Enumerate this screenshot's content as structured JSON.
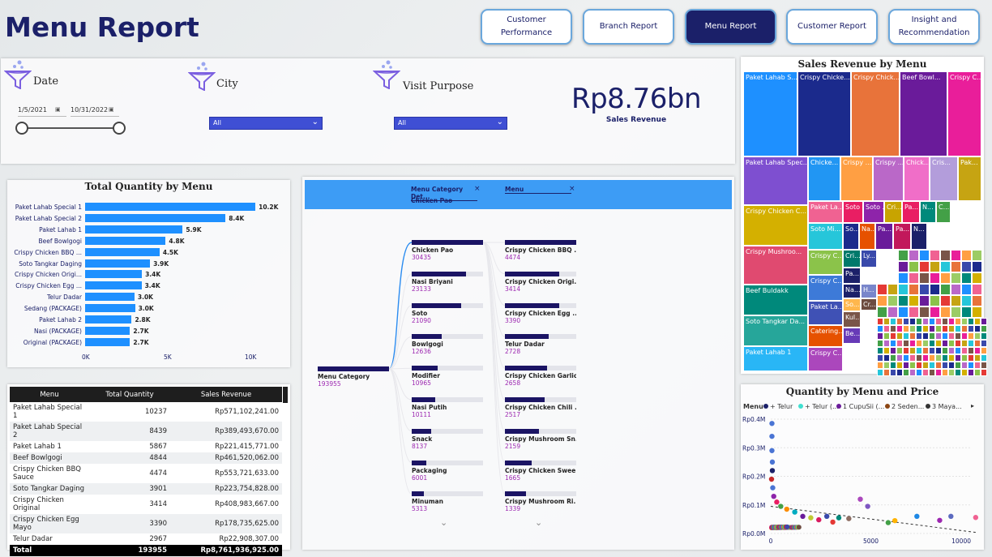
{
  "page": {
    "title": "Menu Report"
  },
  "nav": [
    {
      "label": "Customer Performance",
      "active": false
    },
    {
      "label": "Branch Report",
      "active": false
    },
    {
      "label": "Menu Report",
      "active": true
    },
    {
      "label": "Customer Report",
      "active": false
    },
    {
      "label": "Insight and Recommendation",
      "active": false
    }
  ],
  "filters": {
    "date": {
      "label": "Date",
      "start": "1/5/2021",
      "end": "10/31/2022"
    },
    "city": {
      "label": "City",
      "value": "All"
    },
    "visit_purpose": {
      "label": "Visit Purpose",
      "value": "All"
    }
  },
  "kpi": {
    "value": "Rp8.76bn",
    "label": "Sales Revenue"
  },
  "quantity_chart": {
    "title": "Total Quantity by Menu",
    "ticks": [
      "0K",
      "5K",
      "10K"
    ],
    "chart_data": {
      "type": "bar",
      "orientation": "horizontal",
      "categories": [
        "Paket Lahab Special 1",
        "Paket Lahab Special 2",
        "Paket Lahab 1",
        "Beef Bowlgogi",
        "Crispy Chicken BBQ ...",
        "Soto Tangkar Daging",
        "Crispy Chicken Origi...",
        "Crispy Chicken Egg ...",
        "Telur Dadar",
        "Sedang (PACKAGE)",
        "Paket Lahab 2",
        "Nasi (PACKAGE)",
        "Original (PACKAGE)"
      ],
      "values": [
        10237,
        8439,
        5867,
        4844,
        4474,
        3901,
        3414,
        3390,
        2967,
        3000,
        2800,
        2700,
        2700
      ],
      "labels": [
        "10.2K",
        "8.4K",
        "5.9K",
        "4.8K",
        "4.5K",
        "3.9K",
        "3.4K",
        "3.4K",
        "3.0K",
        "3.0K",
        "2.8K",
        "2.7K",
        "2.7K"
      ],
      "xlim": [
        0,
        11000
      ],
      "color": "#1e90ff"
    }
  },
  "table": {
    "headers": [
      "Menu",
      "Total Quantity",
      "Sales Revenue"
    ],
    "rows": [
      [
        "Paket Lahab Special 1",
        "10237",
        "Rp571,102,241.00"
      ],
      [
        "Paket Lahab Special 2",
        "8439",
        "Rp389,493,670.00"
      ],
      [
        "Paket Lahab 1",
        "5867",
        "Rp221,415,771.00"
      ],
      [
        "Beef Bowlgogi",
        "4844",
        "Rp461,520,062.00"
      ],
      [
        "Crispy Chicken BBQ Sauce",
        "4474",
        "Rp553,721,633.00"
      ],
      [
        "Soto Tangkar Daging",
        "3901",
        "Rp223,754,828.00"
      ],
      [
        "Crispy Chicken Original",
        "3414",
        "Rp408,983,667.00"
      ],
      [
        "Crispy Chicken Egg Mayo",
        "3390",
        "Rp178,735,625.00"
      ],
      [
        "Telur Dadar",
        "2967",
        "Rp22,908,307.00"
      ]
    ],
    "total": [
      "Total",
      "193955",
      "Rp8,761,936,925.00"
    ]
  },
  "decomp": {
    "header1": "Menu Category Det...",
    "header1_sub": "Chicken Pao",
    "header2": "Menu",
    "root": {
      "name": "Menu Category",
      "value": "193955"
    },
    "level1": [
      {
        "name": "Chicken Pao",
        "value": "30435",
        "frac": 1.0
      },
      {
        "name": "Nasi Briyani",
        "value": "23133",
        "frac": 0.76
      },
      {
        "name": "Soto",
        "value": "21090",
        "frac": 0.69
      },
      {
        "name": "Bowlgogi",
        "value": "12636",
        "frac": 0.42
      },
      {
        "name": "Modifier",
        "value": "10965",
        "frac": 0.36
      },
      {
        "name": "Nasi Putih",
        "value": "10111",
        "frac": 0.33
      },
      {
        "name": "Snack",
        "value": "8137",
        "frac": 0.27
      },
      {
        "name": "Packaging",
        "value": "6001",
        "frac": 0.2
      },
      {
        "name": "Minuman",
        "value": "5313",
        "frac": 0.17
      }
    ],
    "level2": [
      {
        "name": "Crispy Chicken BBQ ...",
        "value": "4474",
        "frac": 1.0
      },
      {
        "name": "Crispy Chicken Origi...",
        "value": "3414",
        "frac": 0.76
      },
      {
        "name": "Crispy Chicken Egg ...",
        "value": "3390",
        "frac": 0.76
      },
      {
        "name": "Telur Dadar",
        "value": "2728",
        "frac": 0.61
      },
      {
        "name": "Crispy Chicken Garlic...",
        "value": "2658",
        "frac": 0.59
      },
      {
        "name": "Crispy Chicken Chili ...",
        "value": "2517",
        "frac": 0.56
      },
      {
        "name": "Crispy Mushroom Sn...",
        "value": "2159",
        "frac": 0.48
      },
      {
        "name": "Crispy Chicken Swee...",
        "value": "1665",
        "frac": 0.37
      },
      {
        "name": "Crispy Mushroom Ri...",
        "value": "1339",
        "frac": 0.3
      }
    ]
  },
  "treemap": {
    "title": "Sales Revenue by Menu",
    "labels": {
      "t1": "Paket Lahab S...",
      "t2": "Crispy Chicke...",
      "t3": "Crispy Chick...",
      "t4": "Beef Bowl...",
      "t5": "Crispy C...",
      "t6": "Paket Lahab Spec...",
      "t7": "Chicke...",
      "t8": "Crispy ...",
      "t9": "Crispy ...",
      "t10": "Chick...",
      "t11": "Cris...",
      "t12": "Pak...",
      "t13": "Crispy Chicken C...",
      "t14": "Paket La...",
      "t15": "Soto ...",
      "t16": "Soto ...",
      "t17": "Cri...",
      "t18": "Pa...",
      "t19": "N...",
      "t20": "C...",
      "t21": "Soto Mi...",
      "t22": "So...",
      "t23": "Na...",
      "t24": "Pa...",
      "t25": "Pa...",
      "t26": "N...",
      "t27": "Crispy Mushroo...",
      "t28": "Crispy C...",
      "t29": "Cri...",
      "t30": "Ly...",
      "t31": "Pa...",
      "t32": "Beef Buldakk",
      "t33": "Crispy C...",
      "t34": "Na...",
      "t35": "H...",
      "t36": "Cr...",
      "t37": "Paket La...",
      "t38": "So...",
      "t39": "Soto Tangkar Da...",
      "t40": "Catering...",
      "t41": "Kul...",
      "t42": "Be...",
      "t43": "Paket Lahab 1",
      "t44": "Crispy C..."
    }
  },
  "scatter": {
    "title": "Quantity by Menu and Price",
    "legend_title": "Menu",
    "legend": [
      {
        "label": "+ Telur",
        "color": "#1b2069"
      },
      {
        "label": "+ Telur (...",
        "color": "#40e0d0"
      },
      {
        "label": "1 CupuSii (...",
        "color": "#6a1b9a"
      },
      {
        "label": "2 Seden...",
        "color": "#8b4513"
      },
      {
        "label": "3 Maya...",
        "color": "#333333"
      }
    ],
    "chart_data": {
      "type": "scatter",
      "y_ticks": [
        "Rp0.4M",
        "Rp0.3M",
        "Rp0.2M",
        "Rp0.1M",
        "Rp0.0M"
      ],
      "x_ticks": [
        "0",
        "5000",
        "10000"
      ],
      "xlim": [
        0,
        10000
      ],
      "ylim": [
        0,
        400000
      ],
      "points": [
        {
          "x": 60,
          "y": 385000,
          "c": "#4a74d4"
        },
        {
          "x": 60,
          "y": 340000,
          "c": "#4a74d4"
        },
        {
          "x": 60,
          "y": 290000,
          "c": "#4a74d4"
        },
        {
          "x": 80,
          "y": 250000,
          "c": "#4a74d4"
        },
        {
          "x": 80,
          "y": 220000,
          "c": "#1b2069"
        },
        {
          "x": 40,
          "y": 190000,
          "c": "#c62828"
        },
        {
          "x": 100,
          "y": 160000,
          "c": "#4a74d4"
        },
        {
          "x": 150,
          "y": 130000,
          "c": "#8e24aa"
        },
        {
          "x": 300,
          "y": 110000,
          "c": "#e91e63"
        },
        {
          "x": 500,
          "y": 95000,
          "c": "#43a047"
        },
        {
          "x": 800,
          "y": 85000,
          "c": "#fb8c00"
        },
        {
          "x": 1200,
          "y": 75000,
          "c": "#00acc1"
        },
        {
          "x": 1600,
          "y": 60000,
          "c": "#6a1b9a"
        },
        {
          "x": 2000,
          "y": 55000,
          "c": "#c0ca33"
        },
        {
          "x": 2400,
          "y": 48000,
          "c": "#d81b60"
        },
        {
          "x": 2800,
          "y": 60000,
          "c": "#3949ab"
        },
        {
          "x": 3100,
          "y": 40000,
          "c": "#e53935"
        },
        {
          "x": 3400,
          "y": 55000,
          "c": "#00897b"
        },
        {
          "x": 3900,
          "y": 52000,
          "c": "#8d6e63"
        },
        {
          "x": 4474,
          "y": 120000,
          "c": "#ab47bc"
        },
        {
          "x": 4844,
          "y": 95000,
          "c": "#7e57c2"
        },
        {
          "x": 5867,
          "y": 38000,
          "c": "#43a047"
        },
        {
          "x": 6200,
          "y": 45000,
          "c": "#ffb300"
        },
        {
          "x": 7300,
          "y": 60000,
          "c": "#1e88e5"
        },
        {
          "x": 8439,
          "y": 46000,
          "c": "#9c27b0"
        },
        {
          "x": 9000,
          "y": 60000,
          "c": "#5c6bc0"
        },
        {
          "x": 10237,
          "y": 56000,
          "c": "#f06292"
        }
      ]
    }
  }
}
